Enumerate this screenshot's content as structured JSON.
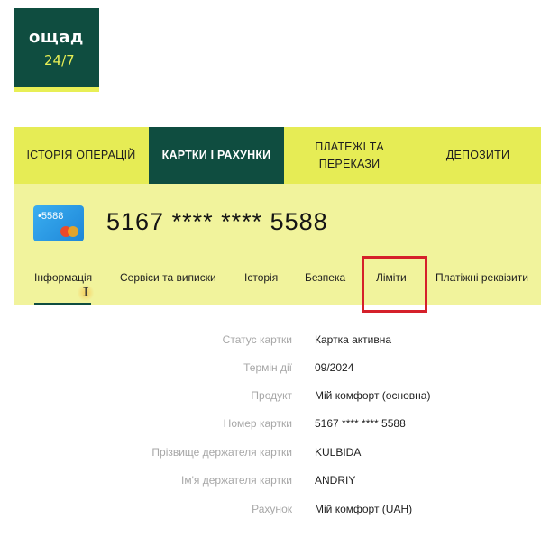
{
  "logo": {
    "brand": "ощад",
    "sub": "24/7"
  },
  "top_nav": [
    {
      "label": "ІСТОРІЯ ОПЕРАЦІЙ"
    },
    {
      "label": "КАРТКИ І РАХУНКИ",
      "active": true
    },
    {
      "label": "ПЛАТЕЖІ ТА ПЕРЕКАЗИ"
    },
    {
      "label": "ДЕПОЗИТИ"
    }
  ],
  "card": {
    "thumb_label": "•5588",
    "number": "5167 **** **** 5588",
    "brand_icon": "mastercard-icon"
  },
  "sub_tabs": [
    {
      "label": "Інформація",
      "active": true
    },
    {
      "label": "Сервіси та виписки"
    },
    {
      "label": "Історія"
    },
    {
      "label": "Безпека"
    },
    {
      "label": "Ліміти",
      "highlighted": true
    },
    {
      "label": "Платіжні реквізити"
    }
  ],
  "details": [
    {
      "label": "Статус картки",
      "value": "Картка активна"
    },
    {
      "label": "Термін дії",
      "value": "09/2024"
    },
    {
      "label": "Продукт",
      "value": "Мій комфорт (основна)"
    },
    {
      "label": "Номер картки",
      "value": "5167 **** **** 5588"
    },
    {
      "label": "Прізвище держателя картки",
      "value": "KULBIDA"
    },
    {
      "label": "Ім'я держателя картки",
      "value": "ANDRIY"
    },
    {
      "label": "Рахунок",
      "value": "Мій комфорт (UAH)"
    }
  ],
  "colors": {
    "brand_green": "#0f4d40",
    "brand_yellow": "#e6ec55",
    "panel_yellow": "#f1f39c",
    "highlight_red": "#d5202a"
  }
}
